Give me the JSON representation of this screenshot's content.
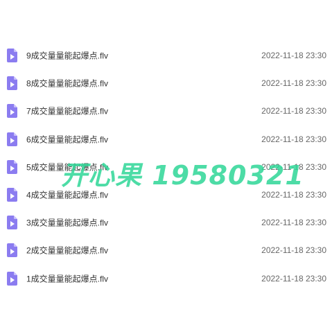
{
  "files": [
    {
      "name": "9成交量量能起爆点.flv",
      "date": "2022-11-18 23:30",
      "icon": "video-file-icon"
    },
    {
      "name": "8成交量量能起爆点.flv",
      "date": "2022-11-18 23:30",
      "icon": "video-file-icon"
    },
    {
      "name": "7成交量量能起爆点.flv",
      "date": "2022-11-18 23:30",
      "icon": "video-file-icon"
    },
    {
      "name": "6成交量量能起爆点.flv",
      "date": "2022-11-18 23:30",
      "icon": "video-file-icon"
    },
    {
      "name": "5成交量量能起爆点.flv",
      "date": "2022-11-18 23:30",
      "icon": "video-file-icon"
    },
    {
      "name": "4成交量量能起爆点.flv",
      "date": "2022-11-18 23:30",
      "icon": "video-file-icon"
    },
    {
      "name": "3成交量量能起爆点.flv",
      "date": "2022-11-18 23:30",
      "icon": "video-file-icon"
    },
    {
      "name": "2成交量量能起爆点.flv",
      "date": "2022-11-18 23:30",
      "icon": "video-file-icon"
    },
    {
      "name": "1成交量量能起爆点.flv",
      "date": "2022-11-18 23:30",
      "icon": "video-file-icon"
    }
  ],
  "watermark": {
    "text": "开心果 19580321",
    "color": "#2ed696"
  },
  "colors": {
    "icon": "#8b7cf0",
    "text": "#333333",
    "date": "#666666"
  }
}
